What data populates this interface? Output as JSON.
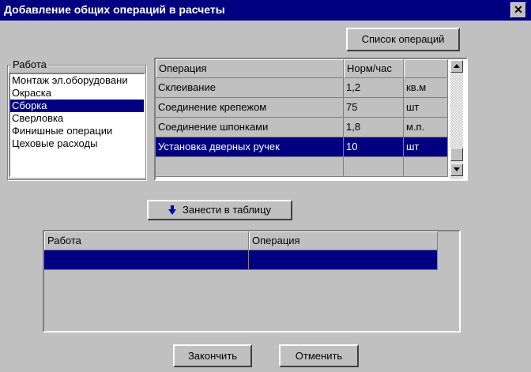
{
  "window": {
    "title": "Добавление общих операций  в расчеты",
    "close_glyph": "✕"
  },
  "buttons": {
    "operations_list": "Список операций",
    "add_to_table": "Занести в таблицу",
    "finish": "Закончить",
    "cancel": "Отменить"
  },
  "work_group": {
    "label": "Работа",
    "items": [
      {
        "label": "Монтаж эл.оборудовани",
        "selected": false
      },
      {
        "label": "Окраска",
        "selected": false
      },
      {
        "label": "Сборка",
        "selected": true
      },
      {
        "label": "Сверловка",
        "selected": false
      },
      {
        "label": "Финишные операции",
        "selected": false
      },
      {
        "label": "Цеховые расходы",
        "selected": false
      }
    ]
  },
  "operations_grid": {
    "columns": [
      "Операция",
      "Норм/час",
      ""
    ],
    "rows": [
      {
        "cells": [
          "Склеивание",
          "1,2",
          "кв.м"
        ],
        "selected": false
      },
      {
        "cells": [
          "Соединение крепежом",
          "75",
          "шт"
        ],
        "selected": false
      },
      {
        "cells": [
          "Соединение шпонками",
          "1,8",
          "м.п."
        ],
        "selected": false
      },
      {
        "cells": [
          "Установка дверных ручек",
          "10",
          "шт"
        ],
        "selected": true
      },
      {
        "cells": [
          "",
          "",
          ""
        ],
        "selected": false
      }
    ]
  },
  "result_grid": {
    "columns": [
      "Работа",
      "Операция"
    ],
    "rows": [
      {
        "cells": [
          "",
          ""
        ],
        "selected": true
      }
    ]
  },
  "colors": {
    "selection": "#000080",
    "face": "#c0c0c0",
    "accent_arrow": "#0000c0"
  },
  "icons": {
    "add_button_icon": "arrow-down-icon",
    "scroll_up": "arrow-up-icon",
    "scroll_down": "arrow-down-icon"
  }
}
